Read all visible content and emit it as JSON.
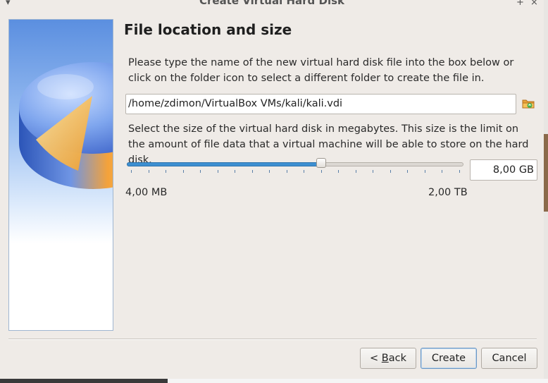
{
  "window": {
    "title": "Create Virtual Hard Disk"
  },
  "titlebar_icons": {
    "menu": "chevron-down-icon",
    "maximize": "plus-icon",
    "close": "close-icon"
  },
  "page": {
    "heading": "File location and size",
    "location_description": "Please type the name of the new virtual hard disk file into the box below or click on the folder icon to select a different folder to create the file in.",
    "file_path": "/home/zdimon/VirtualBox VMs/kali/kali.vdi",
    "size_description": "Select the size of the virtual hard disk in megabytes. This size is the limit on the amount of file data that a virtual machine will be able to store on the hard disk.",
    "slider": {
      "position_fraction": 0.58,
      "min_label": "4,00 MB",
      "max_label": "2,00 TB",
      "tick_count": 20
    },
    "size_value": "8,00 GB"
  },
  "buttons": {
    "back_prefix": "< ",
    "back_mnemonic": "B",
    "back_rest": "ack",
    "create": "Create",
    "cancel": "Cancel"
  },
  "colors": {
    "accent": "#3d8fd1",
    "window_bg": "#efebe7"
  }
}
